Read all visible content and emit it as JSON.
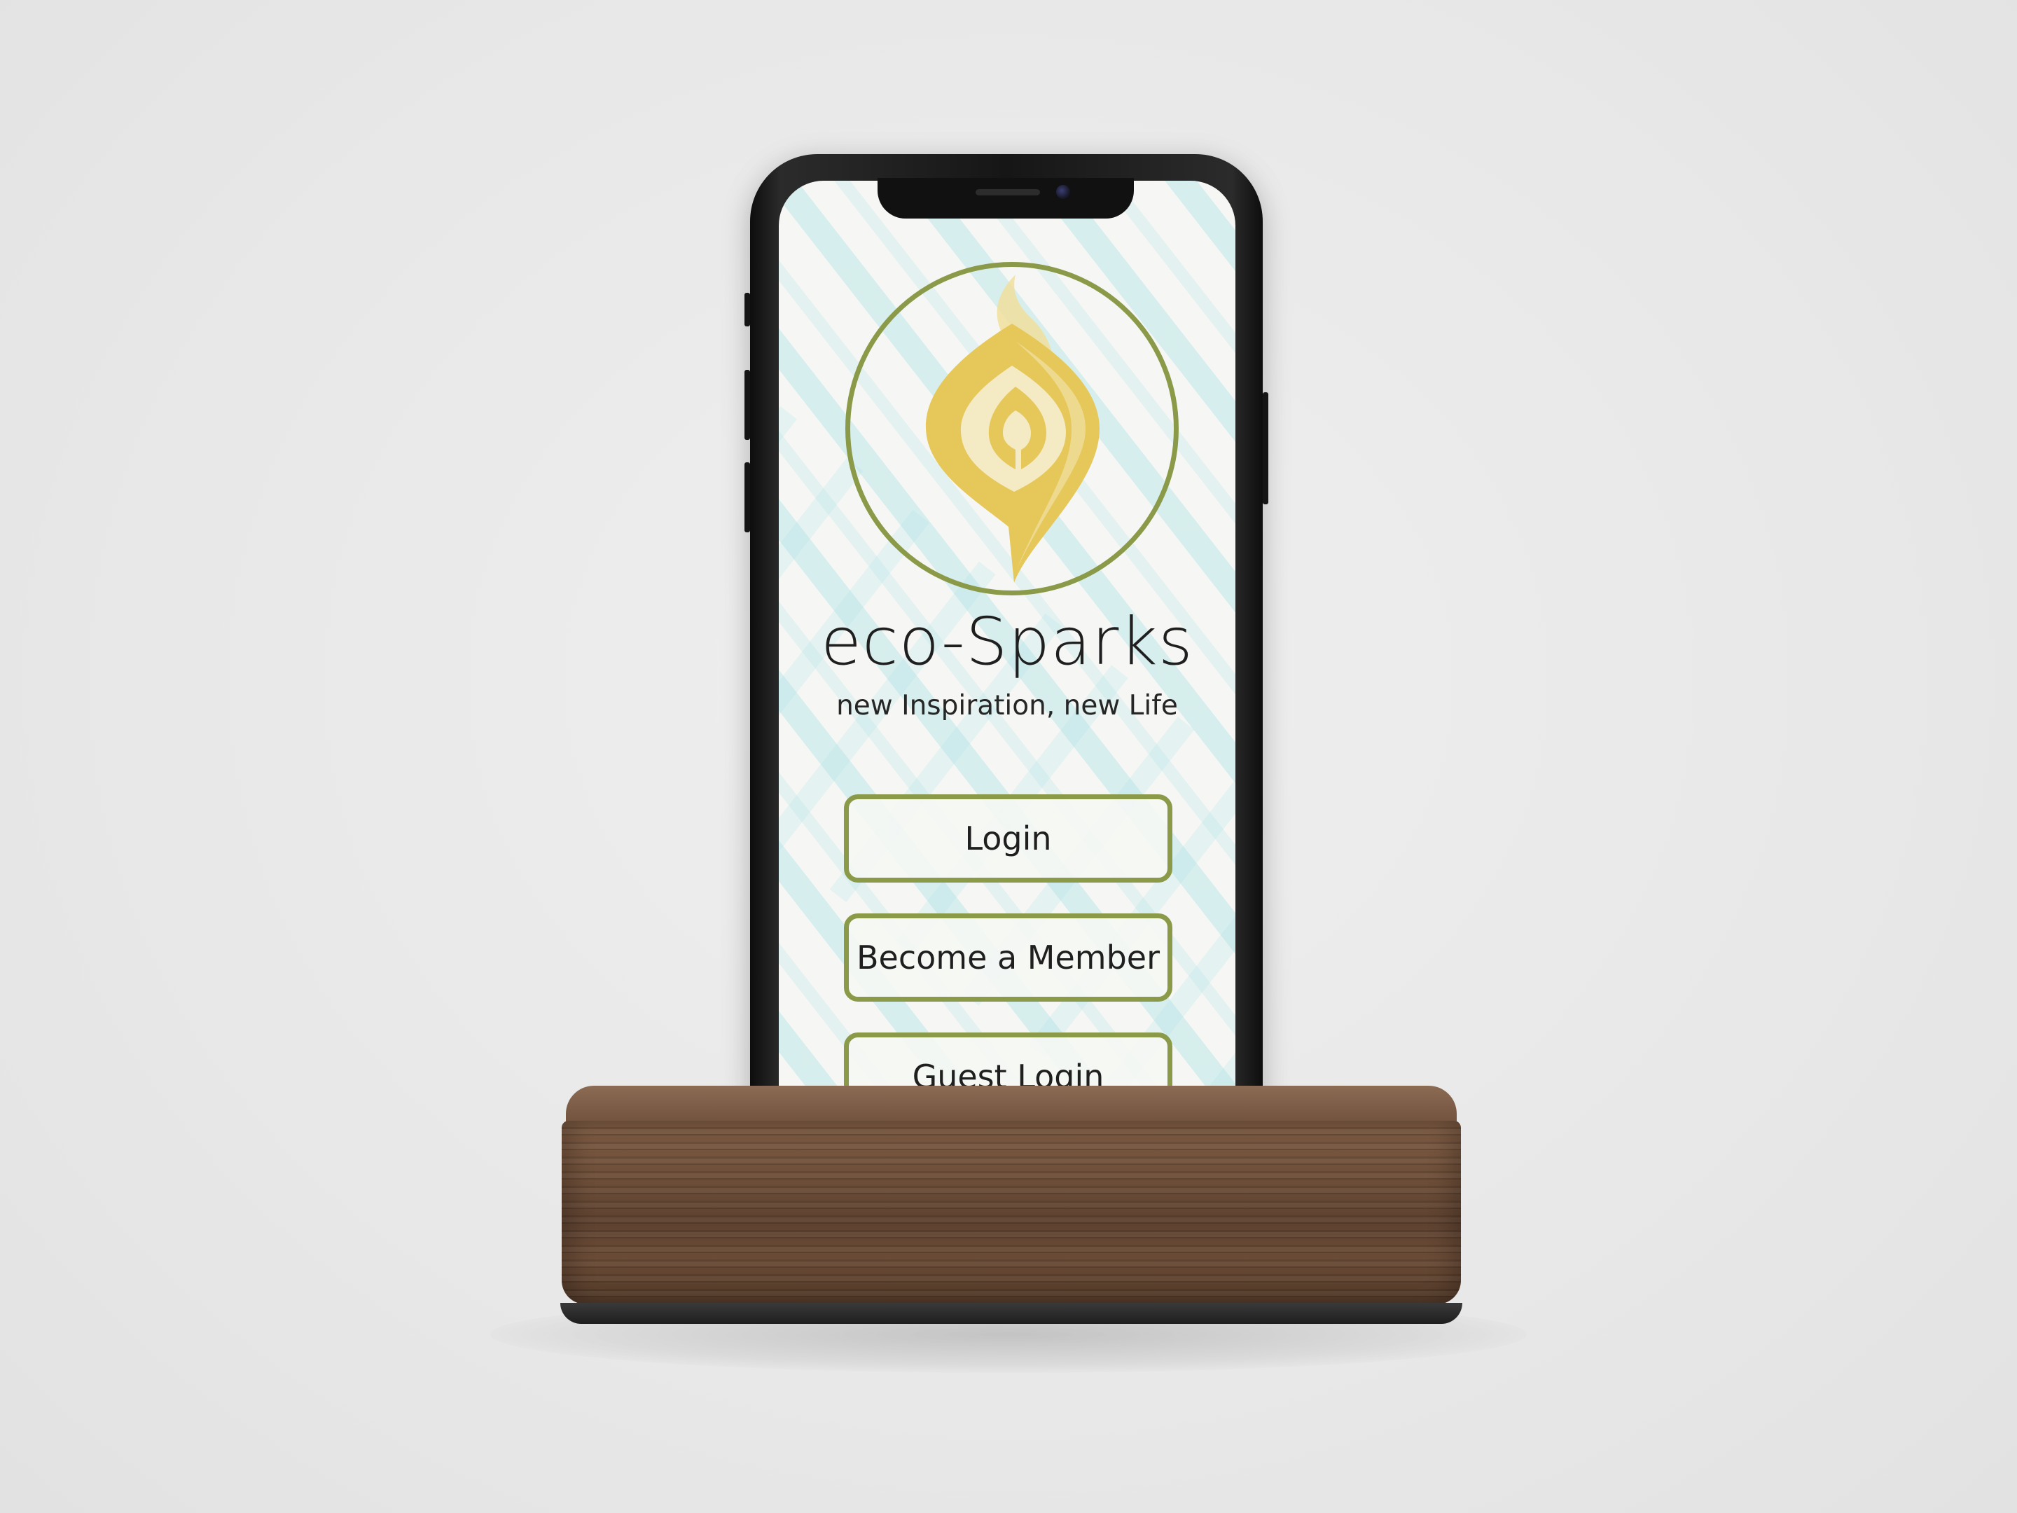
{
  "app": {
    "title": "eco-Sparks",
    "tagline": "new Inspiration, new Life"
  },
  "logo": {
    "icon": "flame-leaf-logo-icon",
    "ring_color": "#8a9a48",
    "flame_color": "#e6c85a"
  },
  "buttons": {
    "login_label": "Login",
    "member_label": "Become a Member",
    "guest_label": "Guest Login"
  },
  "colors": {
    "accent": "#8a9a48",
    "text": "#1f1f1f",
    "pattern": "#aae0e4",
    "wood": "#6e4f39"
  }
}
